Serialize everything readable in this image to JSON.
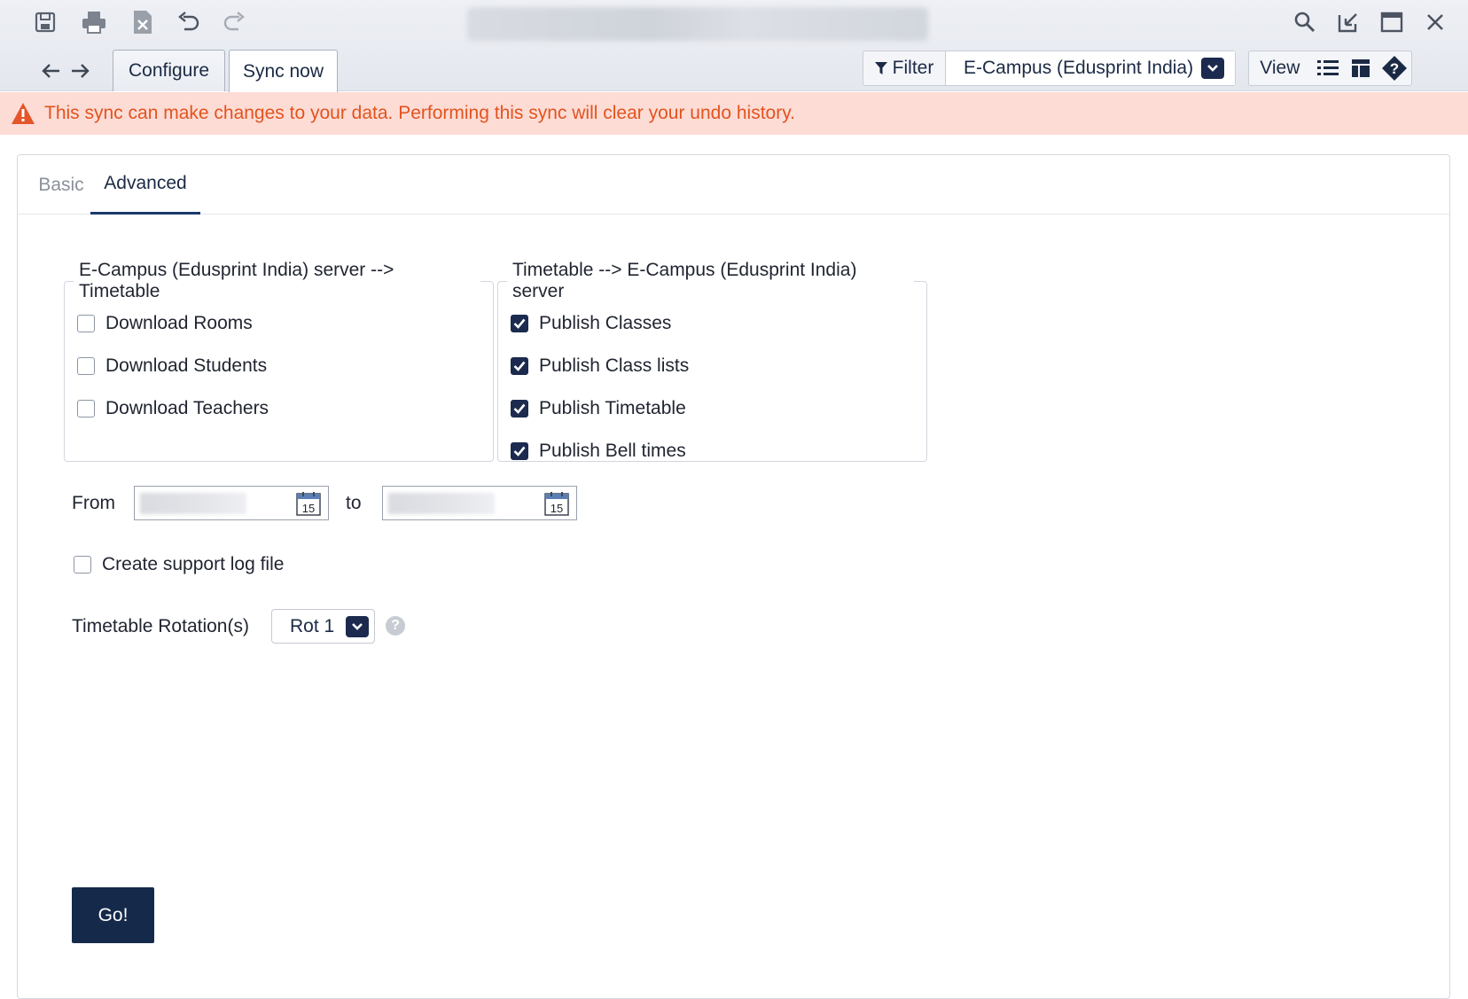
{
  "toolbar": {
    "icons": [
      "save-icon",
      "print-icon",
      "export-icon",
      "undo-icon",
      "redo-icon",
      "search-icon",
      "popout-icon",
      "maximize-icon",
      "close-icon"
    ],
    "nav_back_icon": "arrow-left-icon",
    "nav_forward_icon": "arrow-right-icon"
  },
  "tabs": [
    {
      "label": "Configure",
      "active": false
    },
    {
      "label": "Sync now",
      "active": true
    }
  ],
  "filter": {
    "button_label": "Filter",
    "selected_value": "E-Campus (Edusprint India)"
  },
  "view": {
    "label": "View"
  },
  "warning": {
    "text": "This sync can make changes to your data. Performing this sync will clear your undo history.",
    "color": "#e3531f",
    "background": "#fddcd5"
  },
  "subtabs": [
    {
      "label": "Basic",
      "active": false
    },
    {
      "label": "Advanced",
      "active": true
    }
  ],
  "download_group": {
    "legend": "E-Campus (Edusprint India) server --> Timetable",
    "items": [
      {
        "label": "Download Rooms",
        "checked": false
      },
      {
        "label": "Download Students",
        "checked": false
      },
      {
        "label": "Download Teachers",
        "checked": false
      }
    ]
  },
  "publish_group": {
    "legend": "Timetable --> E-Campus (Edusprint India) server",
    "items": [
      {
        "label": "Publish Classes",
        "checked": true
      },
      {
        "label": "Publish Class lists",
        "checked": true
      },
      {
        "label": "Publish Timetable",
        "checked": true
      },
      {
        "label": "Publish Bell times",
        "checked": true
      }
    ]
  },
  "date_range": {
    "from_label": "From",
    "to_label": "to",
    "calendar_day": "15"
  },
  "support_log": {
    "label": "Create support log file",
    "checked": false
  },
  "rotation": {
    "label": "Timetable Rotation(s)",
    "selected_value": "Rot 1",
    "help_glyph": "?"
  },
  "go_button": {
    "label": "Go!"
  },
  "colors": {
    "accent_navy": "#152a4a",
    "warning_text": "#e3531f"
  }
}
